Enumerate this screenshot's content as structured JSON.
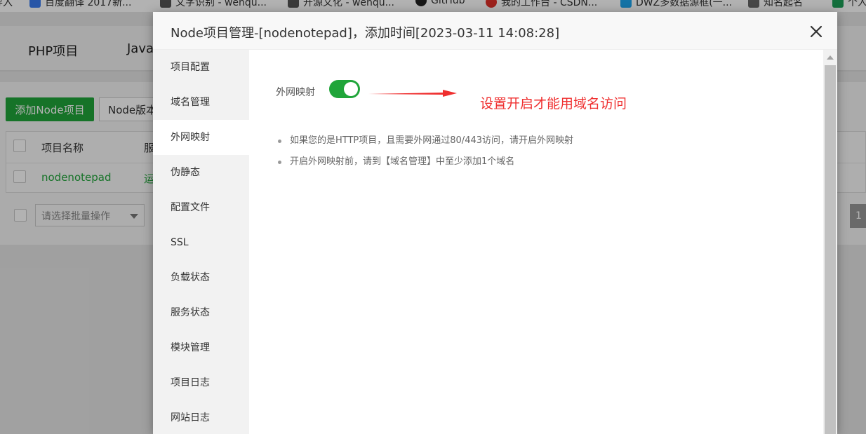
{
  "bookmarks": [
    {
      "label": "导入",
      "color": "#ffffff"
    },
    {
      "label": "百度翻译 2017新...",
      "color": "#3a7cf0"
    },
    {
      "label": "文字识别 - wenqu...",
      "color": "#555555"
    },
    {
      "label": "开源文化 - wenqu...",
      "color": "#555555"
    },
    {
      "label": "GitHub",
      "color": "#222222"
    },
    {
      "label": "我的工作台 - CSDN...",
      "color": "#e0312a"
    },
    {
      "label": "DWZ多数据源框(一...",
      "color": "#1ea5ee"
    },
    {
      "label": "知名起名",
      "color": "#666666"
    },
    {
      "label": "个人",
      "color": "#1e9f58"
    }
  ],
  "background": {
    "tabs": [
      "PHP项目",
      "Java"
    ],
    "add_button": "添加Node项目",
    "version_button": "Node版本",
    "table_header": [
      "项目名称",
      "服"
    ],
    "table_row": [
      "nodenotepad",
      "运"
    ],
    "batch_placeholder": "请选择批量操作",
    "page_number": "1"
  },
  "modal": {
    "title": "Node项目管理-[nodenotepad]，添加时间[2023-03-11 14:08:28]",
    "menu": [
      {
        "label": "项目配置",
        "active": false
      },
      {
        "label": "域名管理",
        "active": false
      },
      {
        "label": "外网映射",
        "active": true
      },
      {
        "label": "伪静态",
        "active": false
      },
      {
        "label": "配置文件",
        "active": false
      },
      {
        "label": "SSL",
        "active": false
      },
      {
        "label": "负载状态",
        "active": false
      },
      {
        "label": "服务状态",
        "active": false
      },
      {
        "label": "模块管理",
        "active": false
      },
      {
        "label": "项目日志",
        "active": false
      },
      {
        "label": "网站日志",
        "active": false
      }
    ],
    "field_label": "外网映射",
    "toggle_on": true,
    "annotation": "设置开启才能用域名访问",
    "tips": [
      "如果您的是HTTP项目，且需要外网通过80/443访问，请开启外网映射",
      "开启外网映射前，请到【域名管理】中至少添加1个域名"
    ]
  },
  "colors": {
    "accent_green": "#20a53a",
    "annotation_red": "#ef2f2f"
  },
  "icons": {
    "close": "close-icon",
    "arrow": "red-arrow-icon"
  }
}
